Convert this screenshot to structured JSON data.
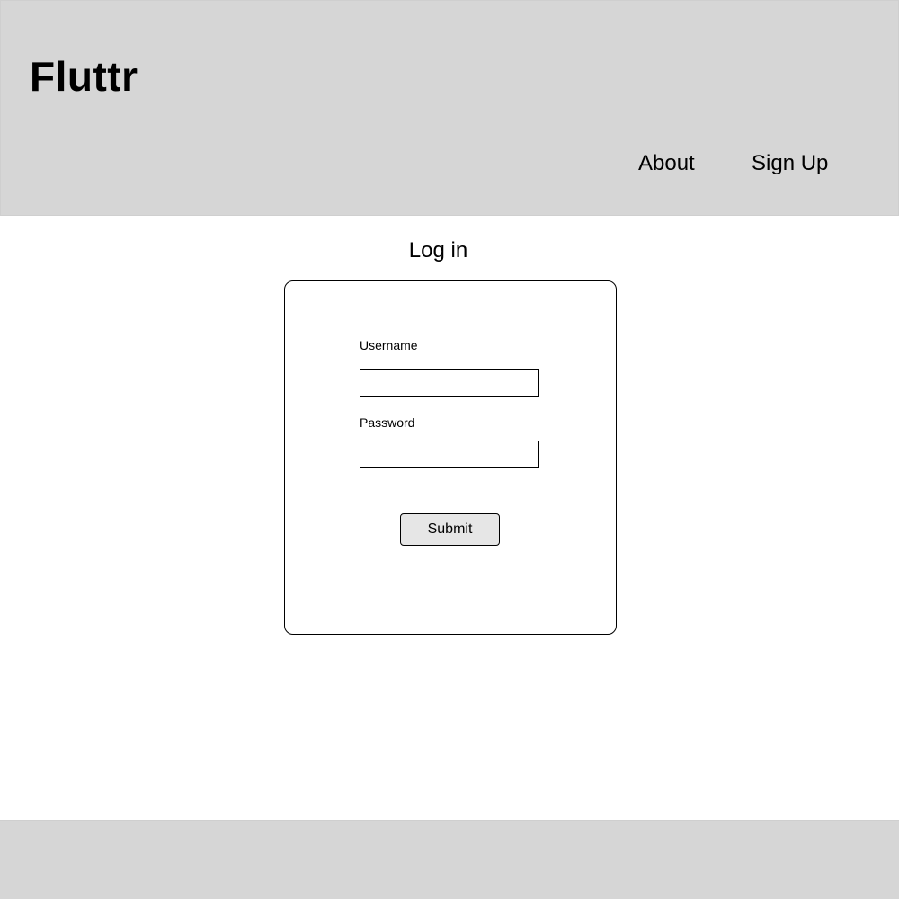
{
  "header": {
    "brand": "Fluttr",
    "nav": {
      "about": "About",
      "sign_up": "Sign Up"
    }
  },
  "login": {
    "title": "Log in",
    "username_label": "Username",
    "username_value": "",
    "password_label": "Password",
    "password_value": "",
    "submit_label": "Submit"
  },
  "colors": {
    "header_bg": "#d6d6d6",
    "footer_bg": "#d6d6d6",
    "button_bg": "#e6e6e6",
    "border": "#000000"
  }
}
